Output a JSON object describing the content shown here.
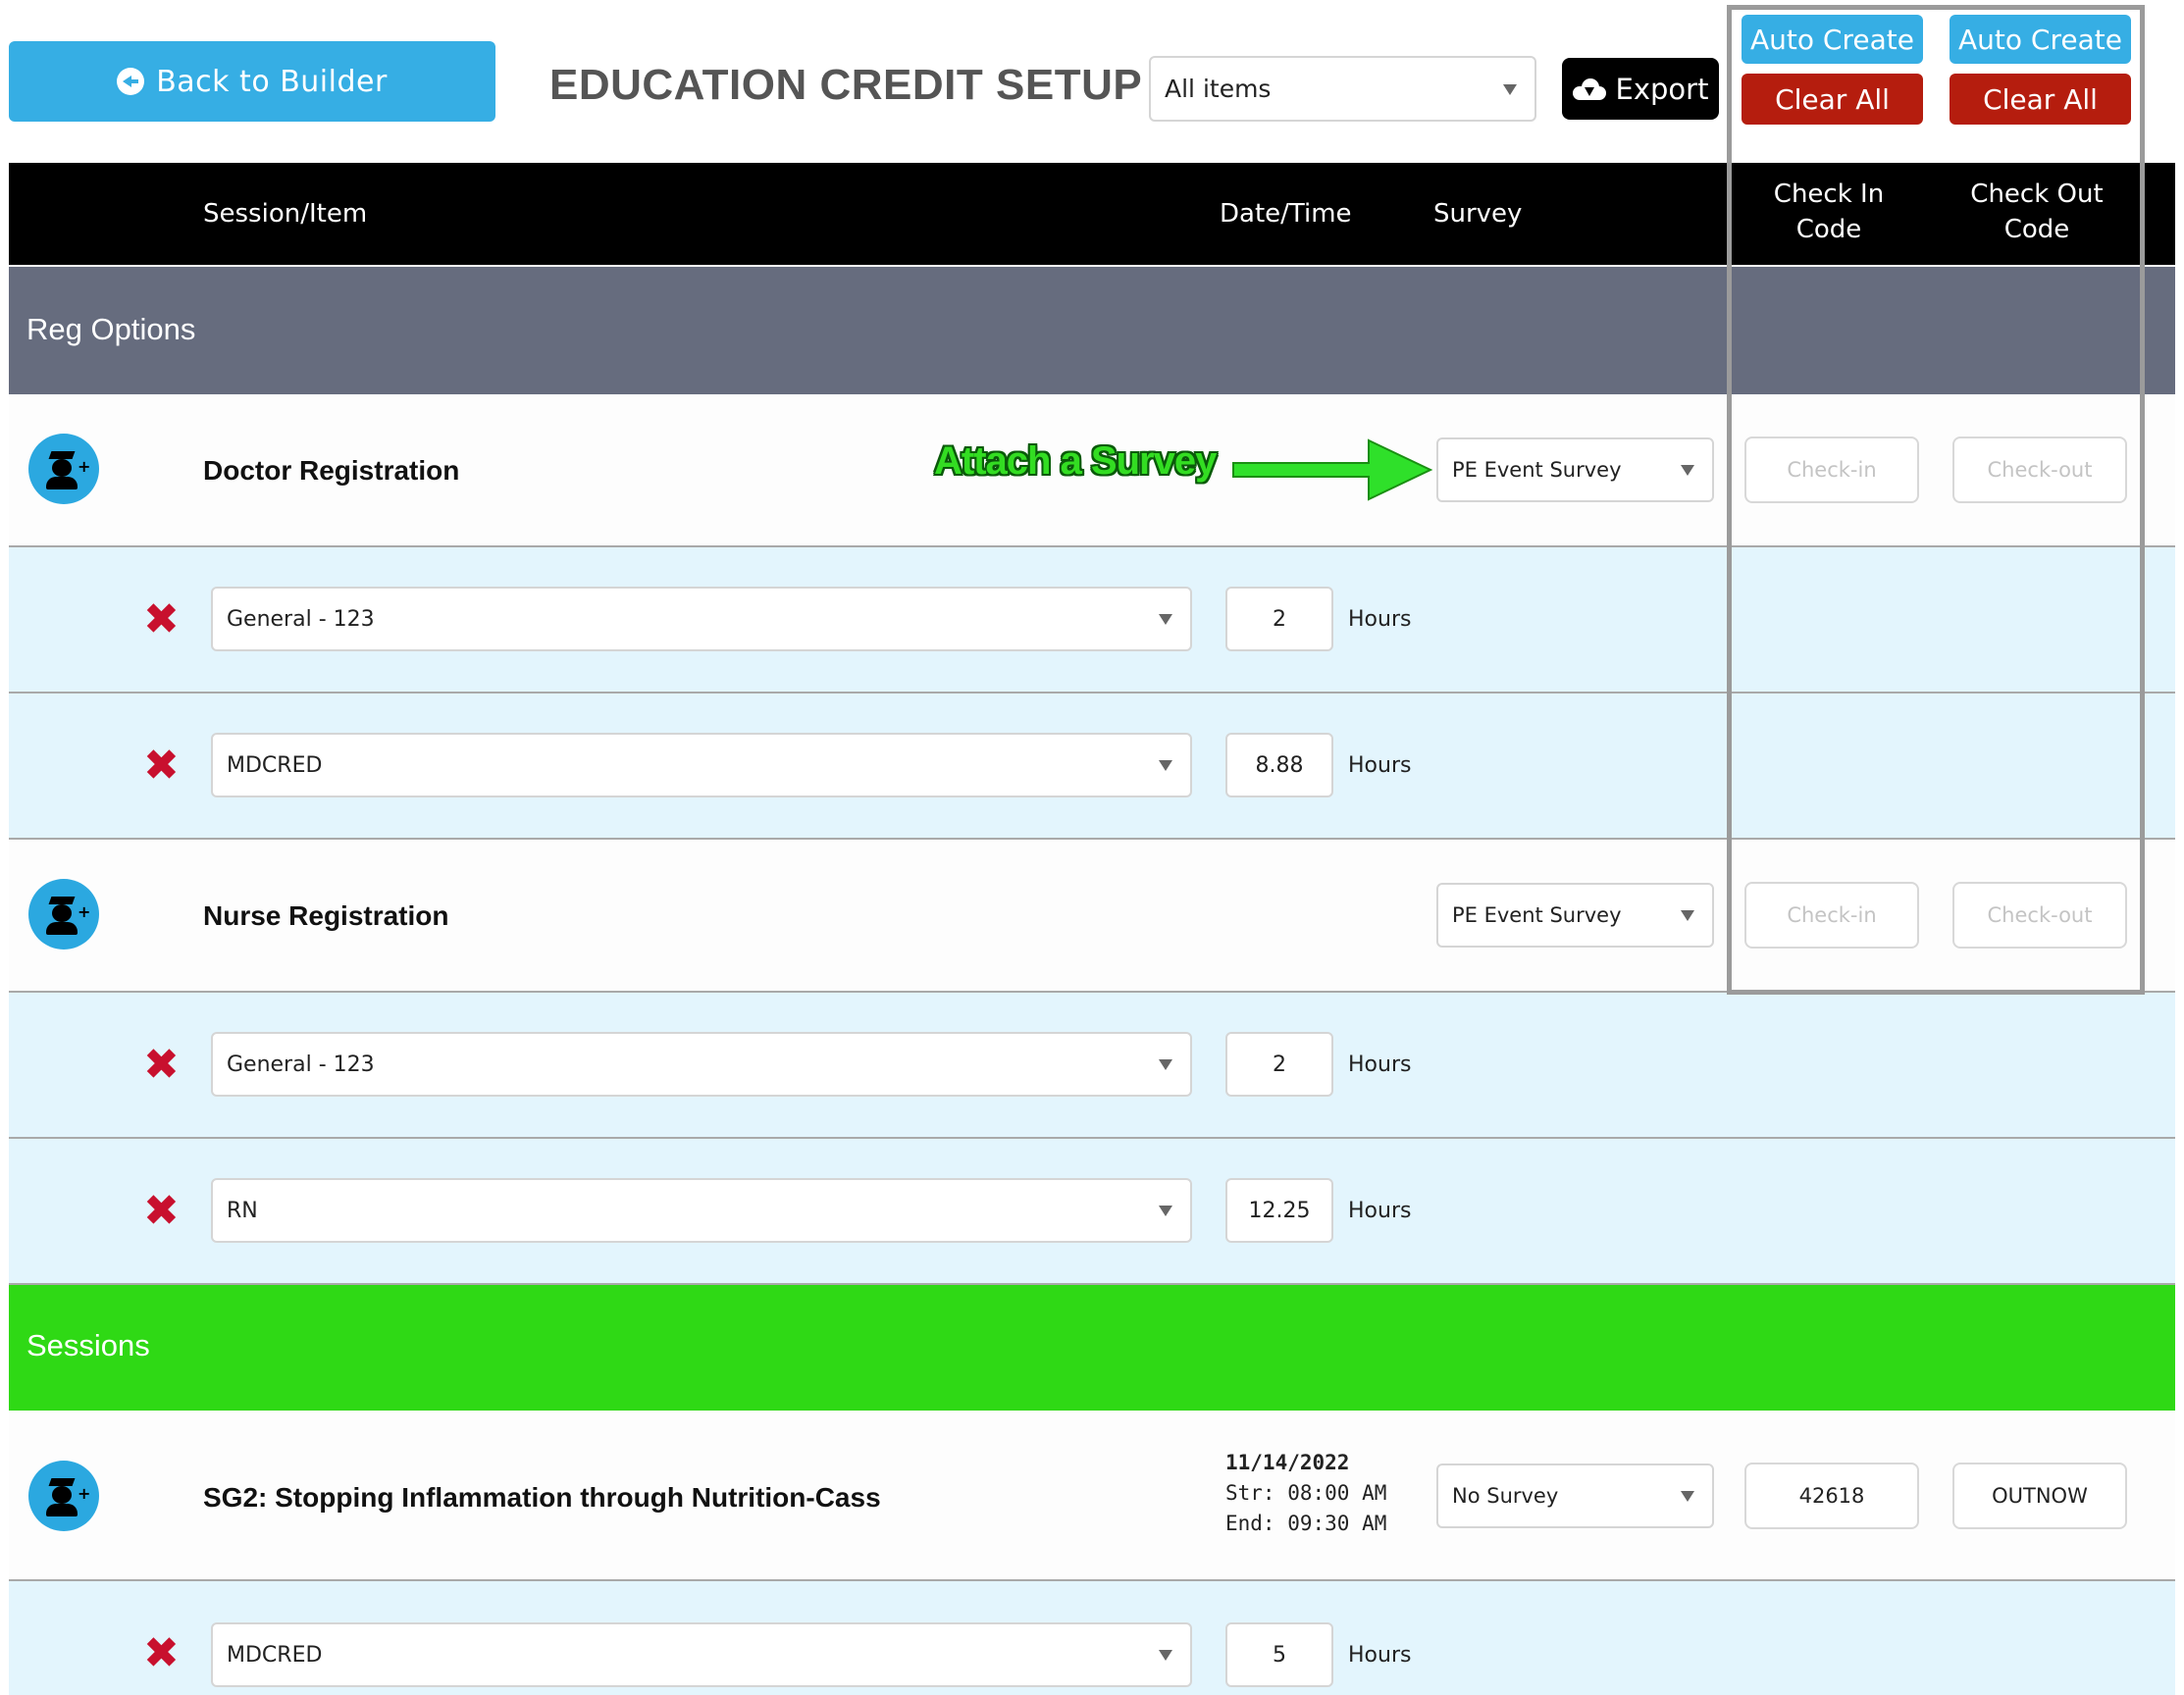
{
  "toolbar": {
    "back_label": "Back to Builder",
    "page_title": "EDUCATION CREDIT SETUP",
    "filter_value": "All items",
    "export_label": "Export",
    "auto_create_label": "Auto Create",
    "clear_all_label": "Clear All"
  },
  "table": {
    "headers": {
      "session_item": "Session/Item",
      "date_time": "Date/Time",
      "survey": "Survey",
      "check_in_code_line1": "Check In",
      "check_in_code_line2": "Code",
      "check_out_code_line1": "Check Out",
      "check_out_code_line2": "Code"
    }
  },
  "bands": {
    "reg_options": "Reg Options",
    "sessions": "Sessions"
  },
  "items": [
    {
      "name": "Doctor Registration",
      "survey": "PE Event Survey",
      "check_in": "Check-in",
      "check_out": "Check-out",
      "credits": [
        {
          "type": "General - 123",
          "hours": "2"
        },
        {
          "type": "MDCRED",
          "hours": "8.88"
        }
      ]
    },
    {
      "name": "Nurse Registration",
      "survey": "PE Event Survey",
      "check_in": "Check-in",
      "check_out": "Check-out",
      "credits": [
        {
          "type": "General - 123",
          "hours": "2"
        },
        {
          "type": "RN",
          "hours": "12.25"
        }
      ]
    },
    {
      "name": "SG2: Stopping Inflammation through Nutrition-Cass",
      "date": "11/14/2022",
      "start": "Str: 08:00 AM",
      "end": "End: 09:30 AM",
      "survey": "No Survey",
      "check_in": "42618",
      "check_out": "OUTNOW",
      "credits": [
        {
          "type": "MDCRED",
          "hours": "5"
        }
      ]
    }
  ],
  "hours_label": "Hours",
  "annotation": "Attach a Survey",
  "icons": {
    "back": "arrow-left-circle-icon",
    "export": "cloud-download-icon",
    "item": "graduate-add-icon",
    "remove": "x-mark-icon",
    "dropdown": "caret-down-icon"
  },
  "colors": {
    "accent_blue": "#36aee4",
    "danger_red": "#b51d0e",
    "reg_options_band": "#666c7e",
    "sessions_band": "#2fd915",
    "credit_row": "#e3f5fd",
    "annotation_green": "#33dd22"
  }
}
